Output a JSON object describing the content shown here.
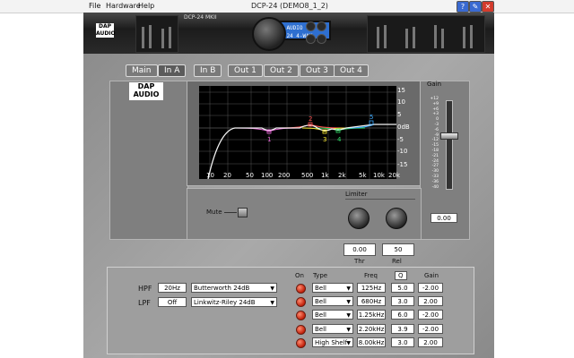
{
  "menu": [
    "File",
    "Hardware",
    "Help"
  ],
  "window_title": "DCP-24 (DEMO8_1_2)",
  "window_buttons": [
    "help",
    "edit",
    "close"
  ],
  "device": {
    "model": "DCP-24 MKII",
    "lcd_line1": "DAP AUDIO",
    "lcd_line2": "DCP-24 4-WAY"
  },
  "tabs": [
    {
      "label": "Main",
      "active": false
    },
    {
      "label": "In A",
      "active": true
    },
    {
      "label": "In B",
      "active": false
    },
    {
      "label": "Out 1",
      "active": false
    },
    {
      "label": "Out 2",
      "active": false
    },
    {
      "label": "Out 3",
      "active": false
    },
    {
      "label": "Out 4",
      "active": false
    }
  ],
  "logo": {
    "line1": "DAP",
    "line2": "AUDIO"
  },
  "graph": {
    "y_labels": [
      "15",
      "10",
      "5",
      "0dB",
      "-5",
      "-10",
      "-15"
    ],
    "x_labels": [
      "10",
      "20",
      "50",
      "100",
      "200",
      "500",
      "1k",
      "2k",
      "5k",
      "10k",
      "20k"
    ],
    "band_labels": [
      "1",
      "2",
      "3",
      "4",
      "5"
    ],
    "tools": [
      "pointer-tool",
      "hand-tool",
      "zoom-tool",
      "info-tool"
    ]
  },
  "gain": {
    "label": "Gain",
    "scale": [
      "+12",
      "+9",
      "+6",
      "+3",
      "0",
      "-3",
      "-6",
      "-9",
      "-12",
      "-15",
      "-18",
      "-21",
      "-24",
      "-27",
      "-30",
      "-33",
      "-36",
      "-40"
    ],
    "value": "0.00",
    "level": 0.6
  },
  "mute": {
    "label": "Mute"
  },
  "limiter": {
    "label": "Limiter",
    "thr_label": "Thr",
    "rel_label": "Rel",
    "thr_value": "0.00",
    "rel_value": "50"
  },
  "filters": {
    "hpf_label": "HPF",
    "hpf_freq": "20Hz",
    "hpf_type": "Butterworth 24dB",
    "lpf_label": "LPF",
    "lpf_freq": "Off",
    "lpf_type": "Linkwitz-Riley 24dB"
  },
  "eq": {
    "headers": {
      "on": "On",
      "type": "Type",
      "freq": "Freq",
      "q": "Q",
      "gain": "Gain"
    },
    "bands": [
      {
        "type": "Bell",
        "freq": "125Hz",
        "q": "5.0",
        "gain": "-2.00"
      },
      {
        "type": "Bell",
        "freq": "680Hz",
        "q": "3.0",
        "gain": "2.00"
      },
      {
        "type": "Bell",
        "freq": "1.25kHz",
        "q": "6.0",
        "gain": "-2.00"
      },
      {
        "type": "Bell",
        "freq": "2.20kHz",
        "q": "3.9",
        "gain": "-2.00"
      },
      {
        "type": "High Shelf",
        "freq": "8.00kHz",
        "q": "3.0",
        "gain": "2.00"
      }
    ]
  },
  "colors": {
    "curve": "#f2f2f2",
    "band1": "#f06ae0",
    "band2": "#ff4d4d",
    "band3": "#ffee33",
    "band4": "#33e06a",
    "band5": "#3aa9ff",
    "lcd": "#2e6fd0",
    "led": "#d0230c"
  }
}
